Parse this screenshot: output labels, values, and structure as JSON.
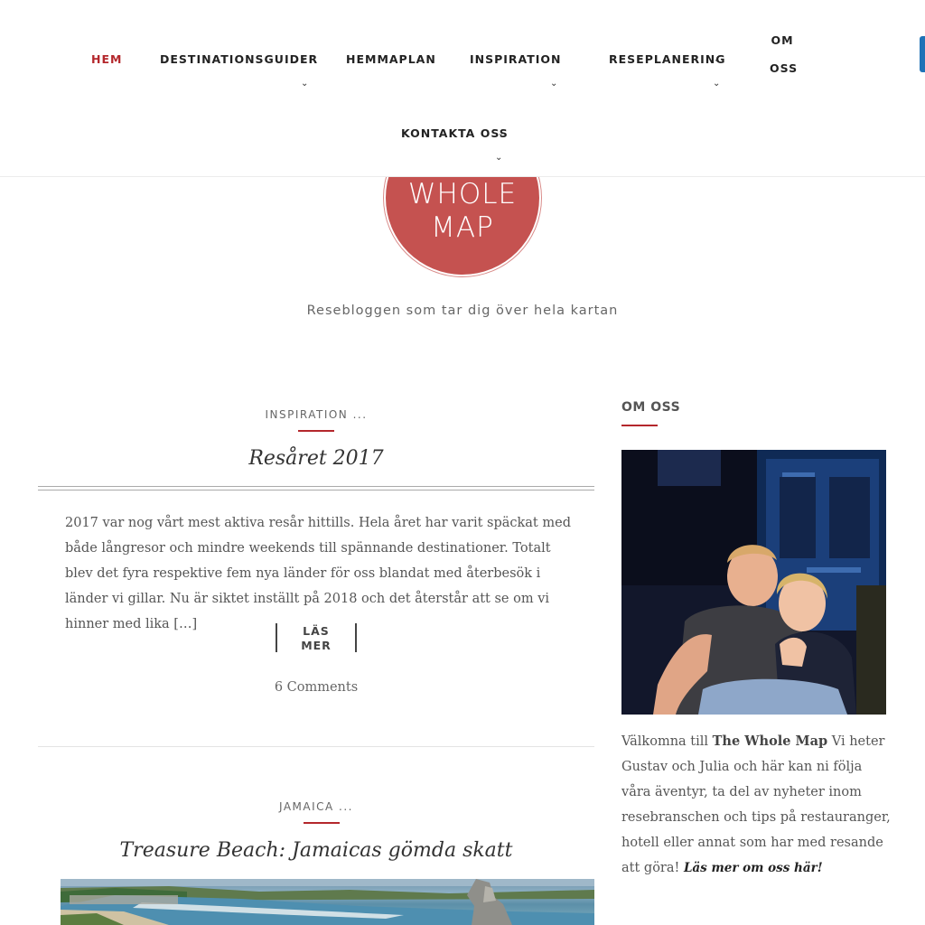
{
  "nav": {
    "items": [
      {
        "label": "HEM"
      },
      {
        "label": "DESTINATIONSGUIDER"
      },
      {
        "label": "HEMMAPLAN"
      },
      {
        "label": "INSPIRATION"
      },
      {
        "label": "RESEPLANERING"
      },
      {
        "label_line1": "OM",
        "label_line2": "OSS"
      },
      {
        "label": "KONTAKTA OSS"
      }
    ],
    "caret_glyph": "⌄",
    "chevron_glyph": "⌄"
  },
  "logo": {
    "line1": "WHOLE",
    "line2": "MAP"
  },
  "tagline": "Resebloggen som tar dig över hela kartan",
  "posts": [
    {
      "category": "INSPIRATION ...",
      "title": "Resåret 2017",
      "excerpt": "2017 var nog vårt mest aktiva resår hittills. Hela året har varit späckat med både långresor och mindre weekends till spännande destinationer. Totalt blev det fyra respektive fem nya länder för oss blandat med återbesök i länder vi gillar. Nu är siktet inställt på 2018 och det återstår att se om vi hinner med lika […]",
      "read_more_line1": "LÄS",
      "read_more_line2": "MER",
      "comments": "6 Comments"
    },
    {
      "category": "JAMAICA ...",
      "title": "Treasure Beach: Jamaicas gömda skatt"
    }
  ],
  "sidebar": {
    "widget_title": "OM OSS",
    "text_intro": "Välkomna till ",
    "text_brand": "The Whole Map",
    "text_body": " Vi heter Gustav och Julia och här kan ni följa våra äventyr, ta del av nyheter inom resebranschen och tips på restauranger, hotell eller annat som har med resande att göra! ",
    "text_link": "Läs mer om oss här!"
  },
  "colors": {
    "accent": "#b4272c",
    "logo": "#c55250",
    "edge_tab": "#1f73b7"
  }
}
